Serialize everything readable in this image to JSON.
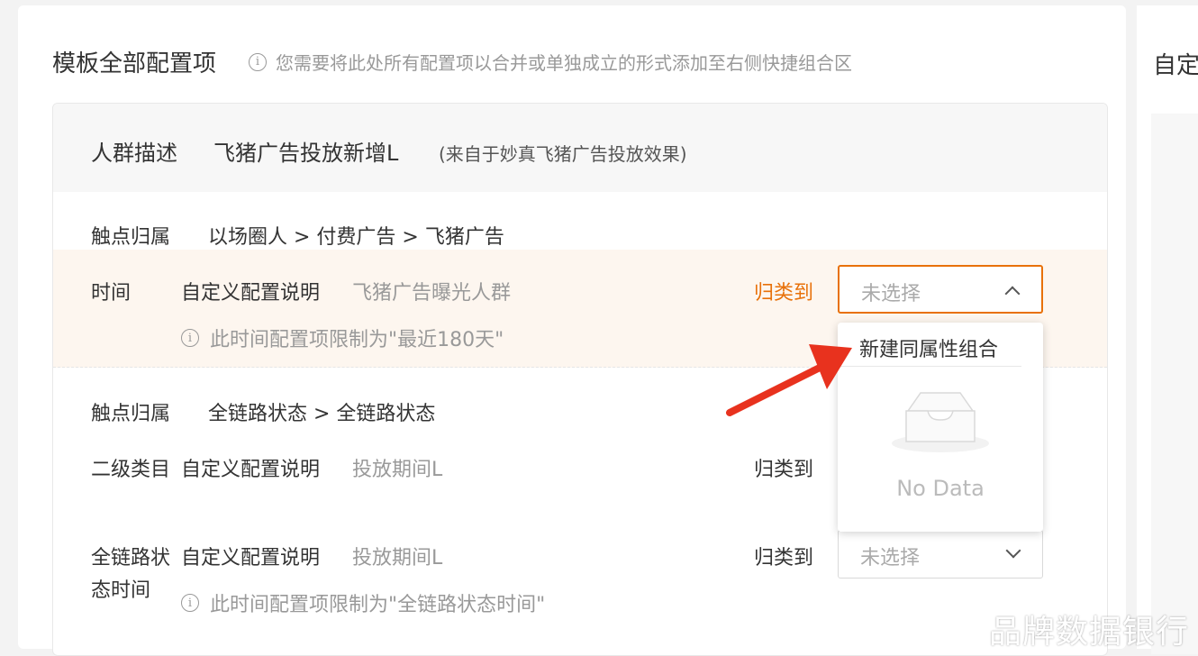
{
  "section": {
    "title": "模板全部配置项",
    "hint": "您需要将此处所有配置项以合并或单独成立的形式添加至右侧快捷组合区"
  },
  "right_panel": {
    "title": "自定"
  },
  "card": {
    "crowd_label": "人群描述",
    "crowd_name": "飞猪广告投放新增L",
    "crowd_source": "(来自于妙真飞猪广告投放效果)"
  },
  "rows": {
    "touch1": {
      "label": "触点归属",
      "value": "以场圈人 > 付费广告 > 飞猪广告"
    },
    "time": {
      "label": "时间",
      "desc_label": "自定义配置说明",
      "desc_value": "飞猪广告曝光人群",
      "classify": "归类到",
      "select_placeholder": "未选择",
      "note": "此时间配置项限制为\"最近180天\""
    },
    "touch2": {
      "label": "触点归属",
      "value": "全链路状态 > 全链路状态"
    },
    "level2": {
      "label": "二级类目",
      "desc_label": "自定义配置说明",
      "desc_value": "投放期间L",
      "classify": "归类到"
    },
    "fullchain": {
      "label_line1": "全链路状",
      "label_line2": "态时间",
      "desc_label": "自定义配置说明",
      "desc_value": "投放期间L",
      "classify": "归类到",
      "select_placeholder": "未选择",
      "note": "此时间配置项限制为\"全链路状态时间\""
    }
  },
  "dropdown": {
    "item": "新建同属性组合",
    "empty_text": "No Data"
  },
  "icons": {
    "info": "info-circle-icon",
    "chevron_up": "chevron-up-icon",
    "chevron_down": "chevron-down-icon",
    "empty": "empty-inbox-icon",
    "arrow": "red-arrow-annotation"
  },
  "colors": {
    "accent": "#e8710a",
    "annotation": "#e8321e"
  },
  "watermark": "品牌数据银行"
}
